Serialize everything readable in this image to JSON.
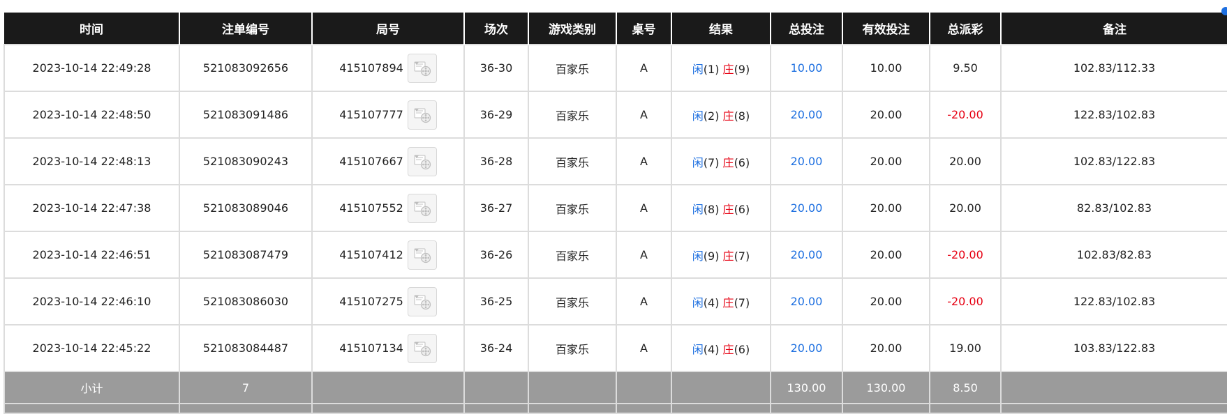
{
  "colors": {
    "header_bg": "#1a1a1a",
    "stake_blue": "#1d6fe0",
    "negative_red": "#e60012",
    "subtotal_bg": "#9b9b9b"
  },
  "headers": [
    "时间",
    "注单编号",
    "局号",
    "场次",
    "游戏类别",
    "桌号",
    "结果",
    "总投注",
    "有效投注",
    "总派彩",
    "备注"
  ],
  "rows": [
    {
      "time": "2023-10-14 22:49:28",
      "bet_no": "521083092656",
      "round_no": "415107894",
      "session": "36-30",
      "game": "百家乐",
      "table": "A",
      "player_label": "闲",
      "player_val": "(1)",
      "banker_label": "庄",
      "banker_val": "(9)",
      "total_bet": "10.00",
      "valid_bet": "10.00",
      "payout": "9.50",
      "payout_negative": false,
      "remark": "102.83/112.33"
    },
    {
      "time": "2023-10-14 22:48:50",
      "bet_no": "521083091486",
      "round_no": "415107777",
      "session": "36-29",
      "game": "百家乐",
      "table": "A",
      "player_label": "闲",
      "player_val": "(2)",
      "banker_label": "庄",
      "banker_val": "(8)",
      "total_bet": "20.00",
      "valid_bet": "20.00",
      "payout": "-20.00",
      "payout_negative": true,
      "remark": "122.83/102.83"
    },
    {
      "time": "2023-10-14 22:48:13",
      "bet_no": "521083090243",
      "round_no": "415107667",
      "session": "36-28",
      "game": "百家乐",
      "table": "A",
      "player_label": "闲",
      "player_val": "(7)",
      "banker_label": "庄",
      "banker_val": "(6)",
      "total_bet": "20.00",
      "valid_bet": "20.00",
      "payout": "20.00",
      "payout_negative": false,
      "remark": "102.83/122.83"
    },
    {
      "time": "2023-10-14 22:47:38",
      "bet_no": "521083089046",
      "round_no": "415107552",
      "session": "36-27",
      "game": "百家乐",
      "table": "A",
      "player_label": "闲",
      "player_val": "(8)",
      "banker_label": "庄",
      "banker_val": "(6)",
      "total_bet": "20.00",
      "valid_bet": "20.00",
      "payout": "20.00",
      "payout_negative": false,
      "remark": "82.83/102.83"
    },
    {
      "time": "2023-10-14 22:46:51",
      "bet_no": "521083087479",
      "round_no": "415107412",
      "session": "36-26",
      "game": "百家乐",
      "table": "A",
      "player_label": "闲",
      "player_val": "(9)",
      "banker_label": "庄",
      "banker_val": "(7)",
      "total_bet": "20.00",
      "valid_bet": "20.00",
      "payout": "-20.00",
      "payout_negative": true,
      "remark": "102.83/82.83"
    },
    {
      "time": "2023-10-14 22:46:10",
      "bet_no": "521083086030",
      "round_no": "415107275",
      "session": "36-25",
      "game": "百家乐",
      "table": "A",
      "player_label": "闲",
      "player_val": "(4)",
      "banker_label": "庄",
      "banker_val": "(7)",
      "total_bet": "20.00",
      "valid_bet": "20.00",
      "payout": "-20.00",
      "payout_negative": true,
      "remark": "122.83/102.83"
    },
    {
      "time": "2023-10-14 22:45:22",
      "bet_no": "521083084487",
      "round_no": "415107134",
      "session": "36-24",
      "game": "百家乐",
      "table": "A",
      "player_label": "闲",
      "player_val": "(4)",
      "banker_label": "庄",
      "banker_val": "(6)",
      "total_bet": "20.00",
      "valid_bet": "20.00",
      "payout": "19.00",
      "payout_negative": false,
      "remark": "103.83/122.83"
    }
  ],
  "subtotal": {
    "label": "小计",
    "count": "7",
    "total_bet": "130.00",
    "valid_bet": "130.00",
    "payout": "8.50"
  },
  "icons": {
    "replay": "video-replay-icon"
  }
}
